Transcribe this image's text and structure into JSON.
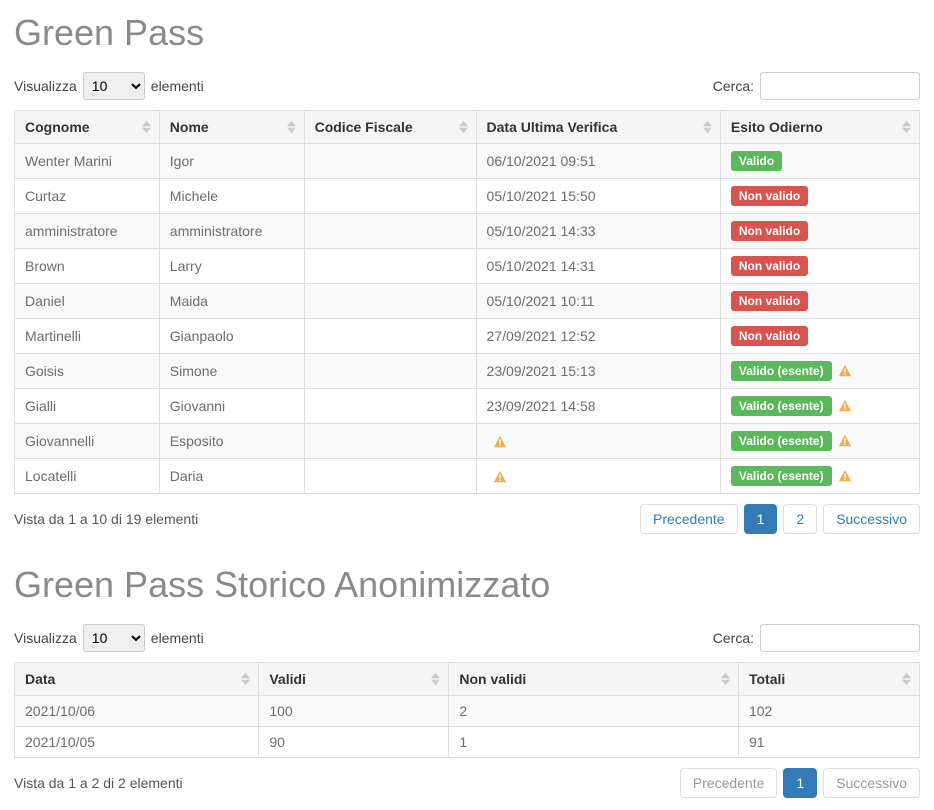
{
  "labels": {
    "show": "Visualizza",
    "entries": "elementi",
    "search": "Cerca:",
    "prev": "Precedente",
    "next": "Successivo",
    "perPage": "10"
  },
  "greenPass": {
    "title": "Green Pass",
    "columns": [
      "Cognome",
      "Nome",
      "Codice Fiscale",
      "Data Ultima Verifica",
      "Esito Odierno"
    ],
    "rows": [
      {
        "cognome": "Wenter Marini",
        "nome": "Igor",
        "cf": "",
        "data": "06/10/2021 09:51",
        "esito": {
          "label": "Valido",
          "type": "success",
          "warn": false
        },
        "dataWarn": false
      },
      {
        "cognome": "Curtaz",
        "nome": "Michele",
        "cf": "",
        "data": "05/10/2021 15:50",
        "esito": {
          "label": "Non valido",
          "type": "danger",
          "warn": false
        },
        "dataWarn": false
      },
      {
        "cognome": "amministratore",
        "nome": "amministratore",
        "cf": "",
        "data": "05/10/2021 14:33",
        "esito": {
          "label": "Non valido",
          "type": "danger",
          "warn": false
        },
        "dataWarn": false
      },
      {
        "cognome": "Brown",
        "nome": "Larry",
        "cf": "",
        "data": "05/10/2021 14:31",
        "esito": {
          "label": "Non valido",
          "type": "danger",
          "warn": false
        },
        "dataWarn": false
      },
      {
        "cognome": "Daniel",
        "nome": "Maida",
        "cf": "",
        "data": "05/10/2021 10:11",
        "esito": {
          "label": "Non valido",
          "type": "danger",
          "warn": false
        },
        "dataWarn": false
      },
      {
        "cognome": "Martinelli",
        "nome": "Gianpaolo",
        "cf": "",
        "data": "27/09/2021 12:52",
        "esito": {
          "label": "Non valido",
          "type": "danger",
          "warn": false
        },
        "dataWarn": false
      },
      {
        "cognome": "Goisis",
        "nome": "Simone",
        "cf": "",
        "data": "23/09/2021 15:13",
        "esito": {
          "label": "Valido (esente)",
          "type": "success",
          "warn": true
        },
        "dataWarn": false
      },
      {
        "cognome": "Gialli",
        "nome": "Giovanni",
        "cf": "",
        "data": "23/09/2021 14:58",
        "esito": {
          "label": "Valido (esente)",
          "type": "success",
          "warn": true
        },
        "dataWarn": false
      },
      {
        "cognome": "Giovannelli",
        "nome": "Esposito",
        "cf": "",
        "data": "",
        "esito": {
          "label": "Valido (esente)",
          "type": "success",
          "warn": true
        },
        "dataWarn": true
      },
      {
        "cognome": "Locatelli",
        "nome": "Daria",
        "cf": "",
        "data": "",
        "esito": {
          "label": "Valido (esente)",
          "type": "success",
          "warn": true
        },
        "dataWarn": true
      }
    ],
    "info": "Vista da 1 a 10 di 19 elementi",
    "pages": [
      {
        "label": "Precedente",
        "active": false,
        "disabled": false
      },
      {
        "label": "1",
        "active": true,
        "disabled": false
      },
      {
        "label": "2",
        "active": false,
        "disabled": false
      },
      {
        "label": "Successivo",
        "active": false,
        "disabled": false
      }
    ]
  },
  "history": {
    "title": "Green Pass Storico Anonimizzato",
    "columns": [
      "Data",
      "Validi",
      "Non validi",
      "Totali"
    ],
    "rows": [
      {
        "data": "2021/10/06",
        "validi": "100",
        "nonvalidi": "2",
        "totali": "102"
      },
      {
        "data": "2021/10/05",
        "validi": "90",
        "nonvalidi": "1",
        "totali": "91"
      }
    ],
    "info": "Vista da 1 a 2 di 2 elementi",
    "pages": [
      {
        "label": "Precedente",
        "active": false,
        "disabled": true
      },
      {
        "label": "1",
        "active": true,
        "disabled": false
      },
      {
        "label": "Successivo",
        "active": false,
        "disabled": true
      }
    ]
  }
}
